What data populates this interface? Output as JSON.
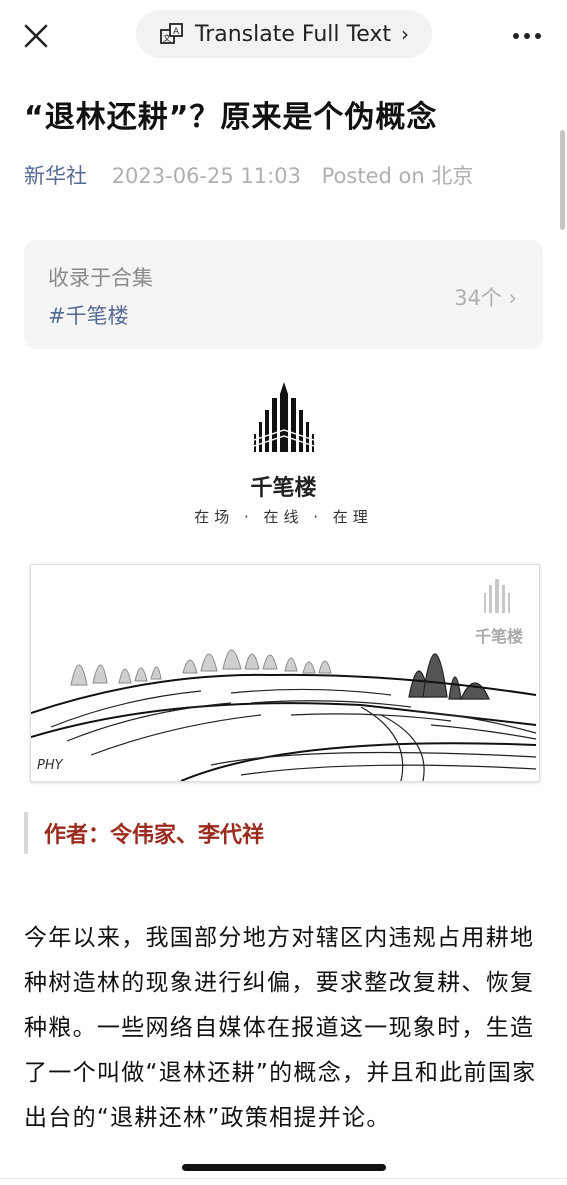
{
  "topbar": {
    "translate_label": "Translate Full Text",
    "translate_chevron": "›",
    "close_icon": "close-icon",
    "more_icon": "more-icon"
  },
  "article": {
    "title": "“退林还耕”？原来是个伪概念",
    "source": "新华社",
    "datetime": "2023-06-25 11:03",
    "posted_on": "Posted on 北京"
  },
  "collection": {
    "label": "收录于合集",
    "tag": "#千笔楼",
    "count": "34个 ›"
  },
  "logo": {
    "name": "千笔楼",
    "slogan": "在场 · 在线 · 在理"
  },
  "illustration": {
    "watermark": "千笔楼",
    "signature": "PHY"
  },
  "author": {
    "line": "作者：令伟家、李代祥"
  },
  "body": {
    "paragraph": "今年以来，我国部分地方对辖区内违规占用耕地种树造林的现象进行纠偏，要求整改复耕、恢复种粮。一些网络自媒体在报道这一现象时，生造了一个叫做“退林还耕”的概念，并且和此前国家出台的“退耕还林”政策相提并论。"
  },
  "colors": {
    "link_blue": "#576b95",
    "author_red": "#9b2a1f",
    "meta_gray": "#b0b0b0"
  }
}
